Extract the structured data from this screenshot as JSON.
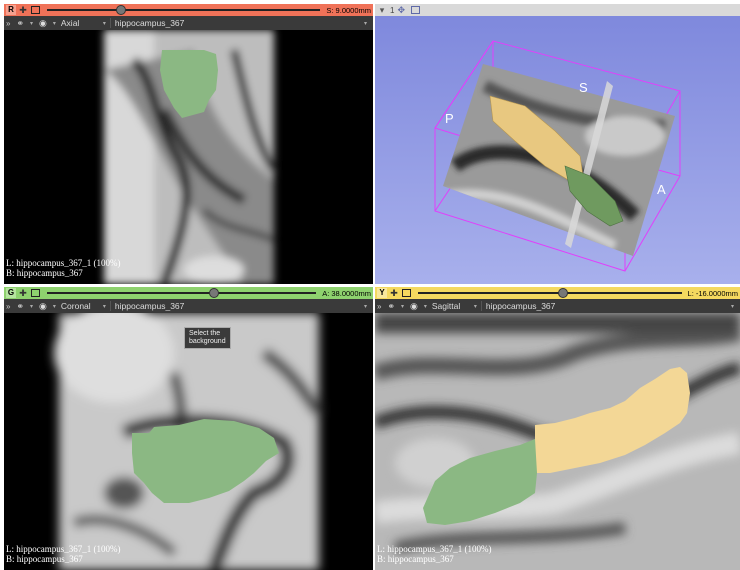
{
  "colors": {
    "red": "#f07258",
    "green": "#8ed26e",
    "yellow": "#f5d95f",
    "hippo_green": "#8bb883",
    "hippo_yellow": "#f3d796"
  },
  "views": {
    "axial": {
      "tag": "R",
      "offset": "S: 9.0000mm",
      "slider_fraction": 0.27,
      "orientation": "Axial",
      "volume": "hippocampus_367",
      "label_line": "L: hippocampus_367_1 (100%)",
      "background_line": "B: hippocampus_367"
    },
    "threed": {
      "view_number": "1",
      "labels": {
        "p": "P",
        "s": "S",
        "a": "A"
      }
    },
    "coronal": {
      "tag": "G",
      "offset": "A: 38.0000mm",
      "slider_fraction": 0.62,
      "orientation": "Coronal",
      "volume": "hippocampus_367",
      "label_line": "L: hippocampus_367_1 (100%)",
      "background_line": "B: hippocampus_367",
      "tooltip": "Select the\nbackground"
    },
    "sagittal": {
      "tag": "Y",
      "offset": "L: -16.0000mm",
      "slider_fraction": 0.55,
      "orientation": "Sagittal",
      "volume": "hippocampus_367",
      "label_line": "L: hippocampus_367_1 (100%)",
      "background_line": "B: hippocampus_367"
    }
  }
}
